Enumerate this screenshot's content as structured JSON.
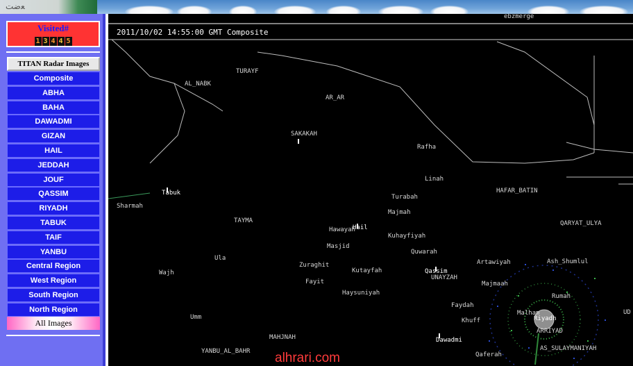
{
  "banner": {
    "logo_text": "ﻌضت"
  },
  "sidebar": {
    "visited": {
      "label": "Visited#",
      "digits": [
        "1",
        "3",
        "4",
        "4",
        "5"
      ]
    },
    "menu_header": "TITAN Radar Images",
    "items": [
      {
        "label": "Composite"
      },
      {
        "label": "ABHA"
      },
      {
        "label": "BAHA"
      },
      {
        "label": "DAWADMI"
      },
      {
        "label": "GIZAN"
      },
      {
        "label": "HAIL"
      },
      {
        "label": "JEDDAH"
      },
      {
        "label": "JOUF"
      },
      {
        "label": "QASSIM"
      },
      {
        "label": "RIYADH"
      },
      {
        "label": "TABUK"
      },
      {
        "label": "TAIF"
      },
      {
        "label": "YANBU"
      },
      {
        "label": "Central Region"
      },
      {
        "label": "West Region"
      },
      {
        "label": "South Region"
      },
      {
        "label": "North Region"
      }
    ],
    "all_images": "All Images"
  },
  "radar": {
    "timestamp": "2011/10/02 14:55:00 GMT Composite",
    "top_clip_text": "ebzmerge",
    "places": [
      {
        "name": "TURAYF"
      },
      {
        "name": "AL_NABK"
      },
      {
        "name": "AR_AR"
      },
      {
        "name": "SAKAKAH"
      },
      {
        "name": "Rafha"
      },
      {
        "name": "Linah"
      },
      {
        "name": "HAFAR_BATIN"
      },
      {
        "name": "Turabah"
      },
      {
        "name": "Tabuk"
      },
      {
        "name": "Sharmah"
      },
      {
        "name": "Majmah"
      },
      {
        "name": "QARYAT_ULYA"
      },
      {
        "name": "TAYMA"
      },
      {
        "name": "Hawayah"
      },
      {
        "name": "Hail"
      },
      {
        "name": "Kuhayfiyah"
      },
      {
        "name": "Masjid"
      },
      {
        "name": "Quwarah"
      },
      {
        "name": "Ula"
      },
      {
        "name": "Artawiyah"
      },
      {
        "name": "Ash_Shumlul"
      },
      {
        "name": "Zuraghit"
      },
      {
        "name": "Kutayfah"
      },
      {
        "name": "Qassim"
      },
      {
        "name": "UNAYZAH"
      },
      {
        "name": "Wajh"
      },
      {
        "name": "Fayit"
      },
      {
        "name": "Majmaah"
      },
      {
        "name": "Haysuniyah"
      },
      {
        "name": "Rumah"
      },
      {
        "name": "Faydah"
      },
      {
        "name": "Malham"
      },
      {
        "name": "Riyadh"
      },
      {
        "name": "Khuff"
      },
      {
        "name": "Umm"
      },
      {
        "name": "ARRIYAD"
      },
      {
        "name": "Dawadmi"
      },
      {
        "name": "MAHJNAH"
      },
      {
        "name": "AS_SULAYMANIYAH"
      },
      {
        "name": "YANBU_AL_BAHR"
      },
      {
        "name": "Qaferah"
      },
      {
        "name": "UD"
      }
    ]
  },
  "watermark": "alhrari.com",
  "colors": {
    "sidebar_bg": "#6f6ff2",
    "menu_item_bg": "#1d1de8",
    "visited_bg": "#ff3333",
    "radar_bg": "#000000",
    "watermark": "#ff3b3b"
  }
}
